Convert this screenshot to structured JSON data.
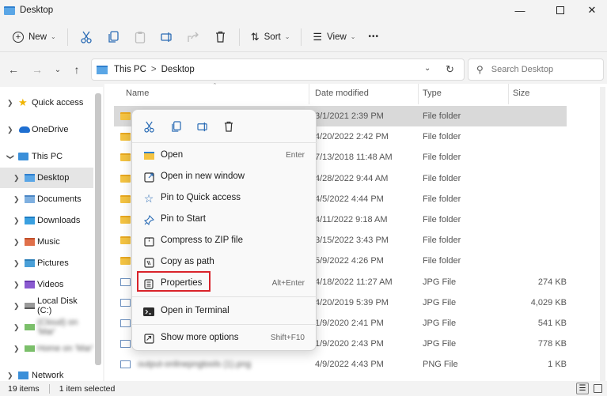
{
  "window": {
    "title": "Desktop"
  },
  "toolbar": {
    "new_label": "New",
    "sort_label": "Sort",
    "view_label": "View",
    "more": "•••"
  },
  "address": {
    "crumbs": [
      "This PC",
      "Desktop"
    ],
    "sep": ">"
  },
  "search": {
    "placeholder": "Search Desktop"
  },
  "sidebar": {
    "items": [
      {
        "label": "Quick access"
      },
      {
        "label": "OneDrive"
      },
      {
        "label": "This PC"
      },
      {
        "label": "Desktop"
      },
      {
        "label": "Documents"
      },
      {
        "label": "Downloads"
      },
      {
        "label": "Music"
      },
      {
        "label": "Pictures"
      },
      {
        "label": "Videos"
      },
      {
        "label": "Local Disk (C:)"
      },
      {
        "label": "(Cloud) on 'Mar'"
      },
      {
        "label": "Home on 'Mar'"
      },
      {
        "label": "Network"
      }
    ]
  },
  "columns": [
    "Name",
    "Date modified",
    "Type",
    "Size"
  ],
  "files": [
    {
      "name": "",
      "date": "3/1/2021 2:39 PM",
      "type": "File folder",
      "size": ""
    },
    {
      "name": "",
      "date": "4/20/2022 2:42 PM",
      "type": "File folder",
      "size": ""
    },
    {
      "name": "",
      "date": "7/13/2018 11:48 AM",
      "type": "File folder",
      "size": ""
    },
    {
      "name": "",
      "date": "4/28/2022 9:44 AM",
      "type": "File folder",
      "size": ""
    },
    {
      "name": "",
      "date": "4/5/2022 4:44 PM",
      "type": "File folder",
      "size": ""
    },
    {
      "name": "",
      "date": "4/11/2022 9:18 AM",
      "type": "File folder",
      "size": ""
    },
    {
      "name": "",
      "date": "3/15/2022 3:43 PM",
      "type": "File folder",
      "size": ""
    },
    {
      "name": "",
      "date": "5/9/2022 4:26 PM",
      "type": "File folder",
      "size": ""
    },
    {
      "name": "",
      "date": "4/18/2022 11:27 AM",
      "type": "JPG File",
      "size": "274 KB"
    },
    {
      "name": "",
      "date": "4/20/2019 5:39 PM",
      "type": "JPG File",
      "size": "4,029 KB"
    },
    {
      "name": "",
      "date": "1/9/2020 2:41 PM",
      "type": "JPG File",
      "size": "541 KB"
    },
    {
      "name": "",
      "date": "1/9/2020 2:43 PM",
      "type": "JPG File",
      "size": "778 KB"
    },
    {
      "name": "output-onlinepngtools (1).png",
      "date": "4/9/2022 4:43 PM",
      "type": "PNG File",
      "size": "1 KB"
    }
  ],
  "context_menu": {
    "items": [
      {
        "label": "Open",
        "shortcut": "Enter",
        "icon": "open-folder-icon"
      },
      {
        "label": "Open in new window",
        "shortcut": "",
        "icon": "new-window-icon"
      },
      {
        "label": "Pin to Quick access",
        "shortcut": "",
        "icon": "star-icon"
      },
      {
        "label": "Pin to Start",
        "shortcut": "",
        "icon": "pin-icon"
      },
      {
        "label": "Compress to ZIP file",
        "shortcut": "",
        "icon": "zip-icon"
      },
      {
        "label": "Copy as path",
        "shortcut": "",
        "icon": "copy-path-icon"
      },
      {
        "label": "Properties",
        "shortcut": "Alt+Enter",
        "icon": "properties-icon"
      },
      {
        "label": "Open in Terminal",
        "shortcut": "",
        "icon": "terminal-icon"
      },
      {
        "label": "Show more options",
        "shortcut": "Shift+F10",
        "icon": "more-options-icon"
      }
    ]
  },
  "status": {
    "items_count": "19 items",
    "selected": "1 item selected"
  },
  "colors": {
    "accent": "#0067c0",
    "highlight_border": "#d9232a",
    "folder": "#f4c342",
    "selection": "#d9d9d9"
  }
}
